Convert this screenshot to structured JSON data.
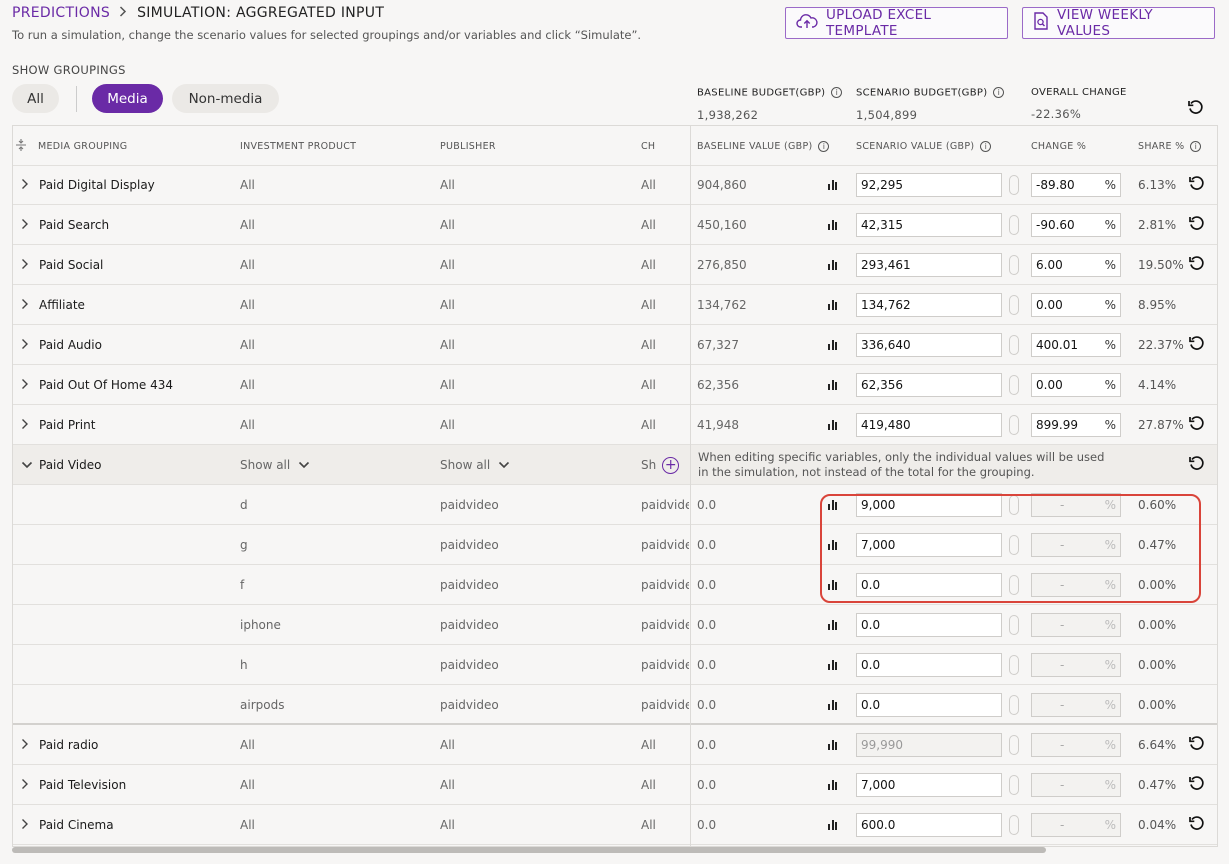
{
  "breadcrumb": {
    "parent": "PREDICTIONS",
    "current": "SIMULATION: AGGREGATED INPUT"
  },
  "subtitle": "To run a simulation, change the scenario values for selected groupings and/or variables and click “Simulate”.",
  "buttons": {
    "upload": "UPLOAD EXCEL TEMPLATE",
    "weekly": "VIEW WEEKLY VALUES"
  },
  "groupings": {
    "label": "SHOW GROUPINGS",
    "all": "All",
    "media": "Media",
    "nonmedia": "Non-media",
    "selected": "Media"
  },
  "budget": {
    "baseline_label": "BASELINE BUDGET(GBP)",
    "baseline_value": "1,938,262",
    "scenario_label": "SCENARIO BUDGET(GBP)",
    "scenario_value": "1,504,899",
    "overall_label": "OVERALL CHANGE",
    "overall_value": "-22.36%"
  },
  "columns": {
    "group": "MEDIA GROUPING",
    "product": "INVESTMENT PRODUCT",
    "publisher": "PUBLISHER",
    "ch": "CH",
    "baseline": "BASELINE VALUE (GBP)",
    "scenario": "SCENARIO VALUE (GBP)",
    "change": "CHANGE %",
    "share": "SHARE %"
  },
  "rows": [
    {
      "group": "Paid Digital Display",
      "product": "All",
      "publisher": "All",
      "ch": "All",
      "baseline": "904,860",
      "scenario": "92,295",
      "change": "-89.80",
      "share": "6.13%",
      "reset": true
    },
    {
      "group": "Paid Search",
      "product": "All",
      "publisher": "All",
      "ch": "All",
      "baseline": "450,160",
      "scenario": "42,315",
      "change": "-90.60",
      "share": "2.81%",
      "reset": true
    },
    {
      "group": "Paid Social",
      "product": "All",
      "publisher": "All",
      "ch": "All",
      "baseline": "276,850",
      "scenario": "293,461",
      "change": "6.00",
      "share": "19.50%",
      "reset": true
    },
    {
      "group": "Affiliate",
      "product": "All",
      "publisher": "All",
      "ch": "All",
      "baseline": "134,762",
      "scenario": "134,762",
      "change": "0.00",
      "share": "8.95%",
      "reset": false
    },
    {
      "group": "Paid Audio",
      "product": "All",
      "publisher": "All",
      "ch": "All",
      "baseline": "67,327",
      "scenario": "336,640",
      "change": "400.01",
      "share": "22.37%",
      "reset": true
    },
    {
      "group": "Paid Out Of Home 434",
      "product": "All",
      "publisher": "All",
      "ch": "All",
      "baseline": "62,356",
      "scenario": "62,356",
      "change": "0.00",
      "share": "4.14%",
      "reset": false
    },
    {
      "group": "Paid Print",
      "product": "All",
      "publisher": "All",
      "ch": "All",
      "baseline": "41,948",
      "scenario": "419,480",
      "change": "899.99",
      "share": "27.87%",
      "reset": true
    }
  ],
  "expanded": {
    "group": "Paid Video",
    "product": "Show all",
    "publisher": "Show all",
    "ch": "Sh",
    "hint": "When editing specific variables, only the individual values will be used in the simulation, not instead of the total for the grouping.",
    "children": [
      {
        "product": "d",
        "publisher": "paidvideo",
        "ch": "paidvide",
        "baseline": "0.0",
        "scenario": "9,000",
        "change": "-",
        "share": "0.60%"
      },
      {
        "product": "g",
        "publisher": "paidvideo",
        "ch": "paidvide",
        "baseline": "0.0",
        "scenario": "7,000",
        "change": "-",
        "share": "0.47%"
      },
      {
        "product": "f",
        "publisher": "paidvideo",
        "ch": "paidvide",
        "baseline": "0.0",
        "scenario": "0.0",
        "change": "-",
        "share": "0.00%"
      },
      {
        "product": "iphone",
        "publisher": "paidvideo",
        "ch": "paidvide",
        "baseline": "0.0",
        "scenario": "0.0",
        "change": "-",
        "share": "0.00%"
      },
      {
        "product": "h",
        "publisher": "paidvideo",
        "ch": "paidvide",
        "baseline": "0.0",
        "scenario": "0.0",
        "change": "-",
        "share": "0.00%"
      },
      {
        "product": "airpods",
        "publisher": "paidvideo",
        "ch": "paidvide",
        "baseline": "0.0",
        "scenario": "0.0",
        "change": "-",
        "share": "0.00%"
      }
    ]
  },
  "rows_after": [
    {
      "group": "Paid radio",
      "product": "All",
      "publisher": "All",
      "ch": "All",
      "baseline": "0.0",
      "scenario": "99,990",
      "scenario_disabled": true,
      "change": "-",
      "share": "6.64%",
      "reset": true
    },
    {
      "group": "Paid Television",
      "product": "All",
      "publisher": "All",
      "ch": "All",
      "baseline": "0.0",
      "scenario": "7,000",
      "scenario_disabled": false,
      "change": "-",
      "share": "0.47%",
      "reset": true
    },
    {
      "group": "Paid Cinema",
      "product": "All",
      "publisher": "All",
      "ch": "All",
      "baseline": "0.0",
      "scenario": "600.0",
      "scenario_disabled": false,
      "change": "-",
      "share": "0.04%",
      "reset": true
    }
  ],
  "icons": {
    "upload": "cloud-upload-icon",
    "weekly": "document-search-icon",
    "reset": "reset-icon",
    "bars": "bar-chart-icon",
    "link": "link-icon",
    "expand": "chevron-right-icon",
    "collapse": "chevron-down-icon",
    "add": "plus-circle-icon",
    "info": "info-icon"
  },
  "colors": {
    "accent": "#6a2aa6",
    "highlight": "#d9443a"
  }
}
